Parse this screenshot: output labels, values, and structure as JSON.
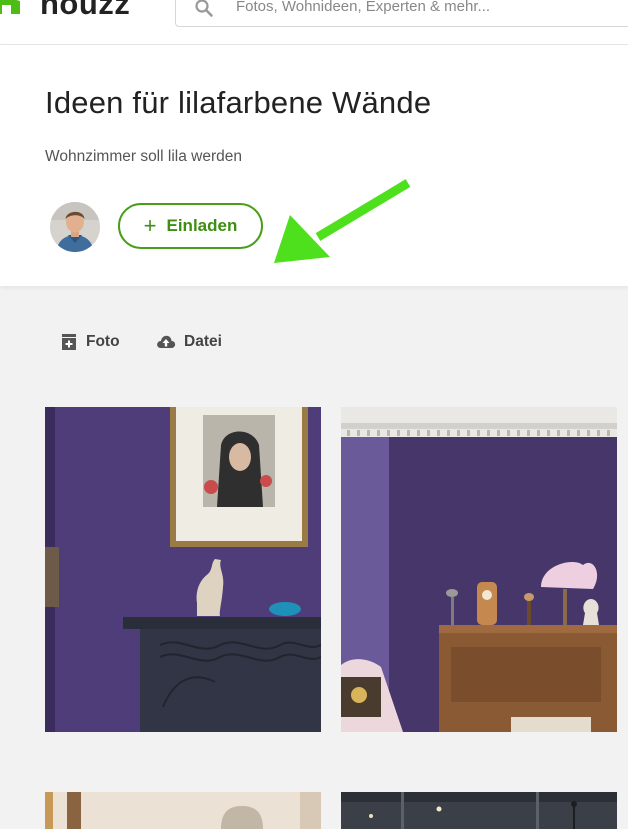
{
  "app": {
    "logo_text": "houzz",
    "brand_color": "#4dbc15"
  },
  "search": {
    "placeholder": "Fotos, Wohnideen, Experten & mehr..."
  },
  "board": {
    "title": "Ideen für lilafarbene Wände",
    "description": "Wohnzimmer soll lila werden",
    "invite_label": "Einladen",
    "invite_icon": "plus-icon"
  },
  "upload": {
    "photo_label": "Foto",
    "file_label": "Datei"
  },
  "colors": {
    "accent_green": "#4a9d1a",
    "annotation_arrow": "#4fe01d",
    "wall_purple": "#4e3d79"
  },
  "photos": [
    "purple-wall-fireplace-room",
    "purple-wall-piano-room",
    "dining-room",
    "modern-interior"
  ]
}
